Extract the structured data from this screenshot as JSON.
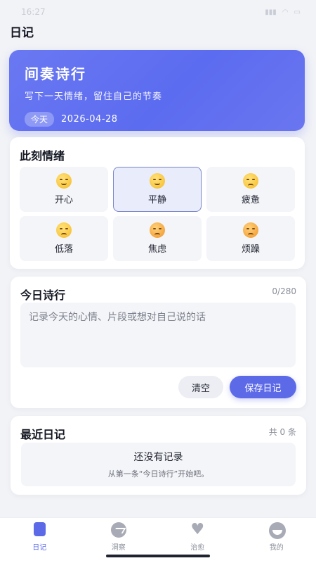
{
  "status": {
    "time": "16:27",
    "icons": [
      "signal-icon",
      "wifi-icon",
      "battery-icon"
    ]
  },
  "page": {
    "title": "日记"
  },
  "hero": {
    "title": "间奏诗行",
    "subtitle": "写下一天情绪，留住自己的节奏",
    "badge": "今天",
    "date": "2026-04-28",
    "accent": "#5c6cf0"
  },
  "mood": {
    "title": "此刻情绪",
    "selected": "平静",
    "items": [
      {
        "label": "开心",
        "icon": "smile-emoji-icon"
      },
      {
        "label": "平静",
        "icon": "relieved-emoji-icon"
      },
      {
        "label": "疲惫",
        "icon": "sleepy-emoji-icon"
      },
      {
        "label": "低落",
        "icon": "pensive-emoji-icon"
      },
      {
        "label": "焦虑",
        "icon": "confounded-emoji-icon"
      },
      {
        "label": "烦躁",
        "icon": "steam-emoji-icon"
      }
    ]
  },
  "poem": {
    "title": "今日诗行",
    "counter": "0/280",
    "value": "",
    "placeholder": "记录今天的心情、片段或想对自己说的话",
    "clear_label": "清空",
    "save_label": "保存日记"
  },
  "recent": {
    "title": "最近日记",
    "count": "共 0 条",
    "empty_title": "还没有记录",
    "empty_sub": "从第一条“今日诗行”开始吧。"
  },
  "tabs": [
    {
      "label": "日记",
      "icon": "diary-icon",
      "active": true
    },
    {
      "label": "洞察",
      "icon": "insight-icon",
      "active": false
    },
    {
      "label": "治愈",
      "icon": "heart-icon",
      "active": false
    },
    {
      "label": "我的",
      "icon": "profile-icon",
      "active": false
    }
  ]
}
